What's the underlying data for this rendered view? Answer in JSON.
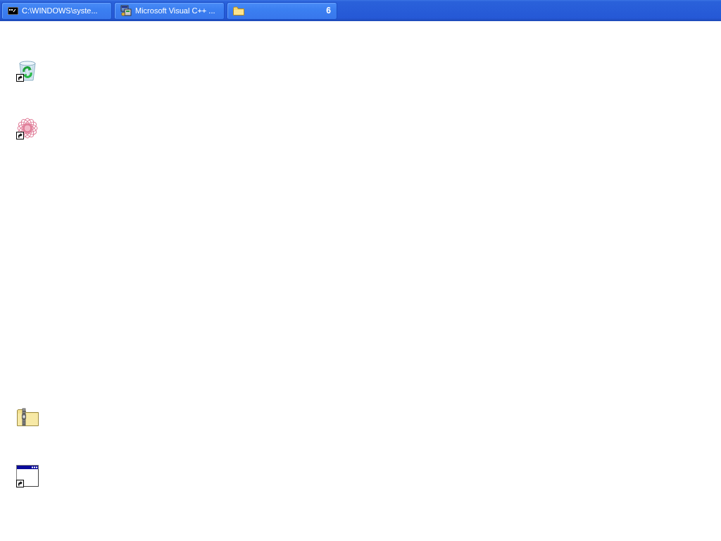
{
  "taskbar": {
    "buttons": [
      {
        "kind": "console",
        "label": "C:\\WINDOWS\\syste..."
      },
      {
        "kind": "app",
        "label": "Microsoft Visual C++ ..."
      },
      {
        "kind": "folder",
        "count": "6"
      }
    ]
  },
  "desktop": {
    "icons": [
      {
        "kind": "recycle-bin",
        "shortcut": true
      },
      {
        "kind": "star-pattern",
        "shortcut": true
      },
      {
        "kind": "zip-folder",
        "shortcut": false
      },
      {
        "kind": "window",
        "shortcut": true
      }
    ]
  }
}
